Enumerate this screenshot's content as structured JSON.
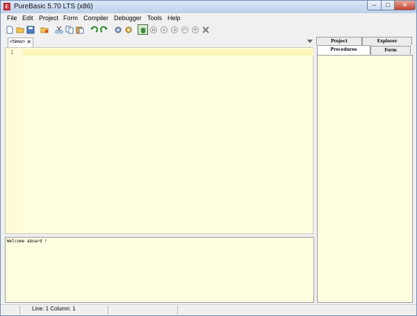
{
  "window": {
    "title": "PureBasic 5.70 LTS (x86)",
    "app_icon_glyph": "E",
    "controls": {
      "minimize": "–",
      "maximize": "□",
      "close": "✕"
    }
  },
  "menu": [
    "File",
    "Edit",
    "Project",
    "Form",
    "Compiler",
    "Debugger",
    "Tools",
    "Help"
  ],
  "toolbar": {
    "icons": [
      "new-file-icon",
      "open-folder-icon",
      "save-icon",
      "save-all-icon",
      "cut-icon",
      "copy-icon",
      "paste-icon",
      "undo-icon",
      "redo-icon",
      "compile-icon",
      "compile-run-icon",
      "debugger-icon",
      "stop-icon",
      "play-icon",
      "step-icon",
      "step-over-icon",
      "step-out-icon",
      "kill-icon"
    ]
  },
  "editor": {
    "tab_label": "<New>",
    "tab_close": "✕",
    "line_numbers": [
      "1"
    ]
  },
  "output": {
    "text": "Welcome aboard !"
  },
  "statusbar": {
    "position": "Line: 1   Column: 1"
  },
  "side_panel": {
    "tabs_top": [
      "Project",
      "Explorer"
    ],
    "tabs_bottom": [
      "Procedures",
      "Form"
    ],
    "selected": "Procedures"
  },
  "colors": {
    "editor_bg": "#fffee0",
    "current_line": "#fdf6b6",
    "accent": "#3c7cc8"
  }
}
